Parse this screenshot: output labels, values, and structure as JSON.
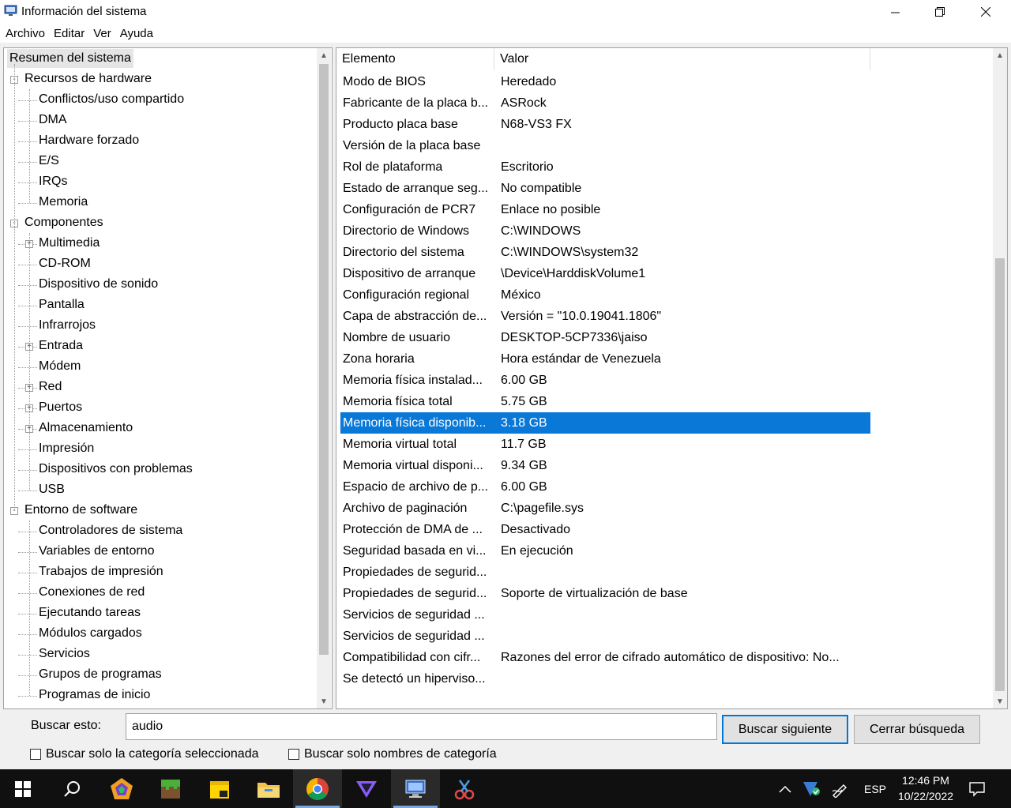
{
  "window": {
    "title": "Información del sistema"
  },
  "menu": [
    "Archivo",
    "Editar",
    "Ver",
    "Ayuda"
  ],
  "tree": {
    "root": "Resumen del sistema",
    "hardware": {
      "label": "Recursos de hardware",
      "children": [
        "Conflictos/uso compartido",
        "DMA",
        "Hardware forzado",
        "E/S",
        "IRQs",
        "Memoria"
      ]
    },
    "components": {
      "label": "Componentes",
      "children": [
        "Multimedia",
        "CD-ROM",
        "Dispositivo de sonido",
        "Pantalla",
        "Infrarrojos",
        "Entrada",
        "Módem",
        "Red",
        "Puertos",
        "Almacenamiento",
        "Impresión",
        "Dispositivos con problemas",
        "USB"
      ]
    },
    "software": {
      "label": "Entorno de software",
      "children": [
        "Controladores de sistema",
        "Variables de entorno",
        "Trabajos de impresión",
        "Conexiones de red",
        "Ejecutando tareas",
        "Módulos cargados",
        "Servicios",
        "Grupos de programas",
        "Programas de inicio"
      ]
    }
  },
  "list": {
    "headers": [
      "Elemento",
      "Valor"
    ],
    "rows": [
      [
        "Modo de BIOS",
        "Heredado"
      ],
      [
        "Fabricante de la placa b...",
        "ASRock"
      ],
      [
        "Producto placa base",
        "N68-VS3 FX"
      ],
      [
        "Versión de la placa base",
        ""
      ],
      [
        "Rol de plataforma",
        "Escritorio"
      ],
      [
        "Estado de arranque seg...",
        "No compatible"
      ],
      [
        "Configuración de PCR7",
        "Enlace no posible"
      ],
      [
        "Directorio de Windows",
        "C:\\WINDOWS"
      ],
      [
        "Directorio del sistema",
        "C:\\WINDOWS\\system32"
      ],
      [
        "Dispositivo de arranque",
        "\\Device\\HarddiskVolume1"
      ],
      [
        "Configuración regional",
        "México"
      ],
      [
        "Capa de abstracción de...",
        "Versión = \"10.0.19041.1806\""
      ],
      [
        "Nombre de usuario",
        "DESKTOP-5CP7336\\jaiso"
      ],
      [
        "Zona horaria",
        "Hora estándar de Venezuela"
      ],
      [
        "Memoria física instalad...",
        "6.00 GB"
      ],
      [
        "Memoria física total",
        "5.75 GB"
      ],
      [
        "Memoria física disponib...",
        "3.18 GB"
      ],
      [
        "Memoria virtual total",
        "11.7 GB"
      ],
      [
        "Memoria virtual disponi...",
        "9.34 GB"
      ],
      [
        "Espacio de archivo de p...",
        "6.00 GB"
      ],
      [
        "Archivo de paginación",
        "C:\\pagefile.sys"
      ],
      [
        "Protección de DMA de ...",
        "Desactivado"
      ],
      [
        "Seguridad basada en vi...",
        "En ejecución"
      ],
      [
        "Propiedades de segurid...",
        ""
      ],
      [
        "Propiedades de segurid...",
        "Soporte de virtualización de base"
      ],
      [
        "Servicios de seguridad ...",
        ""
      ],
      [
        "Servicios de seguridad ...",
        ""
      ],
      [
        "Compatibilidad con cifr...",
        "Razones del error de cifrado automático de dispositivo: No..."
      ],
      [
        "Se detectó un hiperviso...",
        ""
      ]
    ],
    "selected_index": 16
  },
  "search": {
    "label": "Buscar esto:",
    "value": "audio",
    "find_next": "Buscar siguiente",
    "close_search": "Cerrar búsqueda",
    "only_selected": "Buscar solo la categoría seleccionada",
    "only_names": "Buscar solo nombres de categoría"
  },
  "taskbar": {
    "lang": "ESP",
    "time": "12:46 PM",
    "date": "10/22/2022"
  },
  "colors": {
    "selection": "#0a78d7",
    "taskbar": "#101010"
  }
}
